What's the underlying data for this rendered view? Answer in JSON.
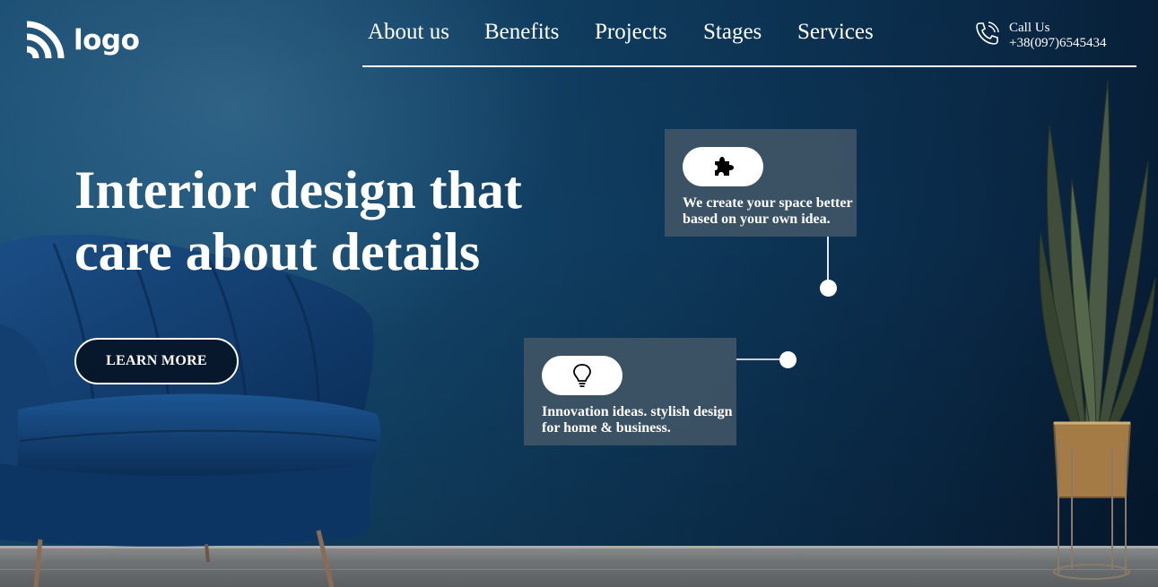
{
  "header": {
    "logo_text": "logo",
    "nav": [
      {
        "label": "About us"
      },
      {
        "label": "Benefits"
      },
      {
        "label": "Projects"
      },
      {
        "label": "Stages"
      },
      {
        "label": "Services"
      }
    ],
    "call_label": "Call Us",
    "phone": "+38(097)6545434"
  },
  "hero": {
    "title_line1": "Interior design that",
    "title_line2": "care about details",
    "button_label": "LEARN MORE"
  },
  "features": [
    {
      "icon": "puzzle-icon",
      "text_line1": "We create your space better",
      "text_line2": "based on your own idea."
    },
    {
      "icon": "lightbulb-icon",
      "text_line1": "Innovation ideas. stylish design",
      "text_line2": "for home & business."
    }
  ],
  "colors": {
    "background": "#0c3556",
    "card": "#425567",
    "button_bg": "#07182c",
    "text": "#ffffff"
  }
}
